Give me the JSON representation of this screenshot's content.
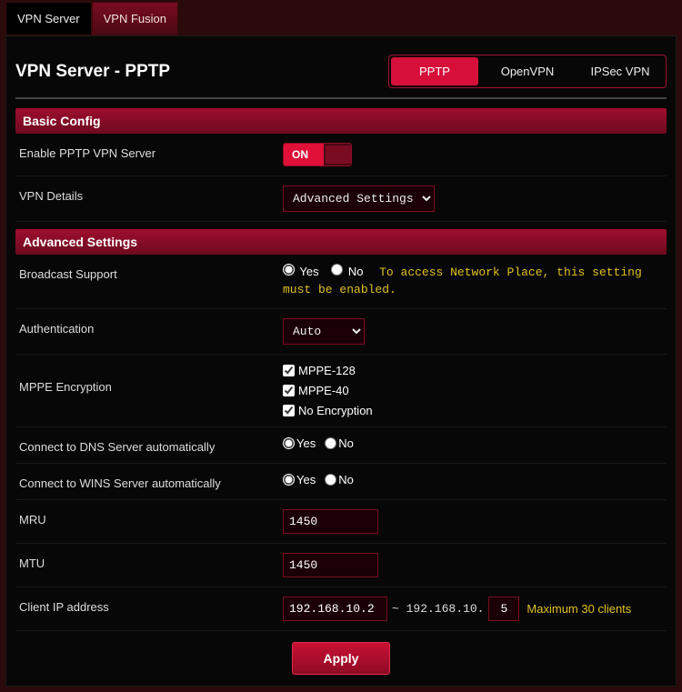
{
  "tabs": {
    "vpn_server": "VPN Server",
    "vpn_fusion": "VPN Fusion"
  },
  "page_title": "VPN Server - PPTP",
  "protocols": {
    "pptp": "PPTP",
    "openvpn": "OpenVPN",
    "ipsec": "IPSec VPN"
  },
  "sections": {
    "basic": "Basic Config",
    "advanced": "Advanced Settings"
  },
  "labels": {
    "enable_server": "Enable PPTP VPN Server",
    "vpn_details": "VPN Details",
    "broadcast": "Broadcast Support",
    "auth": "Authentication",
    "mppe": "MPPE Encryption",
    "dns": "Connect to DNS Server automatically",
    "wins": "Connect to WINS Server automatically",
    "mru": "MRU",
    "mtu": "MTU",
    "client_ip": "Client IP address"
  },
  "values": {
    "toggle_on": "ON",
    "vpn_details_selected": "Advanced Settings",
    "auth_selected": "Auto",
    "mppe128": "MPPE-128",
    "mppe40": "MPPE-40",
    "noenc": "No Encryption",
    "mru": "1450",
    "mtu": "1450",
    "ip_start": "192.168.10.2",
    "ip_mid": "~ 192.168.10.",
    "ip_end": "5"
  },
  "radios": {
    "yes": "Yes",
    "no": "No"
  },
  "hints": {
    "broadcast": "To access Network Place, this setting must be enabled.",
    "max_clients": "Maximum 30 clients"
  },
  "buttons": {
    "apply": "Apply"
  }
}
